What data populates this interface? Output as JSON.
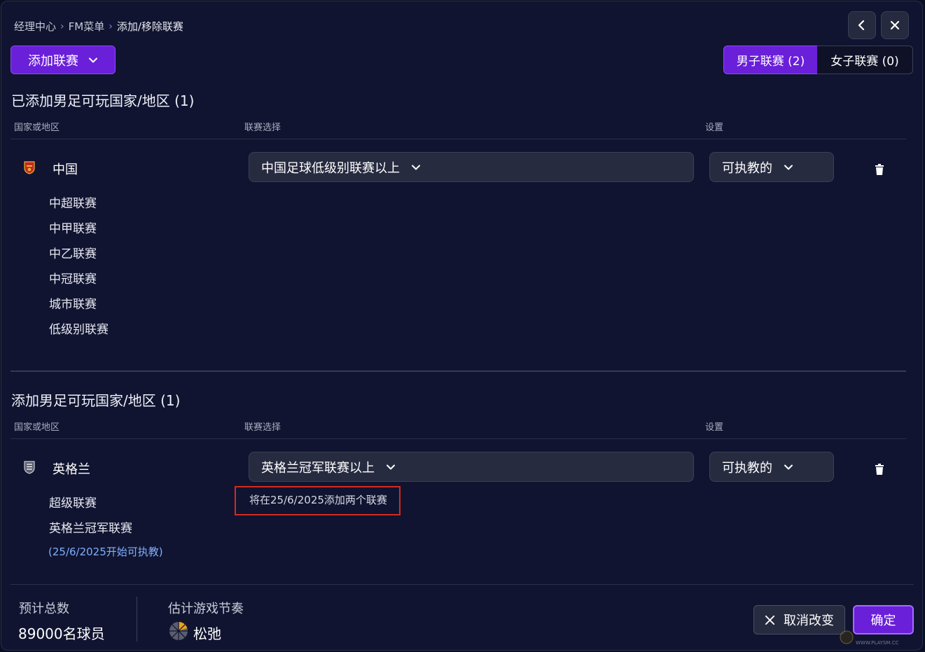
{
  "breadcrumb": {
    "items": [
      "经理中心",
      "FM菜单",
      "添加/移除联赛"
    ]
  },
  "header": {
    "add_league_label": "添加联赛",
    "tabs": {
      "men": "男子联赛 (2)",
      "women": "女子联赛 (0)"
    }
  },
  "added_section": {
    "title": "已添加男足可玩国家/地区 (1)",
    "columns": {
      "country": "国家或地区",
      "league_select": "联赛选择",
      "settings": "设置"
    },
    "country": {
      "name": "中国",
      "league_select": "中国足球低级别联赛以上",
      "setting": "可执教的",
      "leagues": [
        "中超联赛",
        "中甲联赛",
        "中乙联赛",
        "中冠联赛",
        "城市联赛",
        "低级别联赛"
      ]
    }
  },
  "adding_section": {
    "title": "添加男足可玩国家/地区 (1)",
    "columns": {
      "country": "国家或地区",
      "league_select": "联赛选择",
      "settings": "设置"
    },
    "country": {
      "name": "英格兰",
      "league_select": "英格兰冠军联赛以上",
      "setting": "可执教的",
      "leagues": [
        "超级联赛",
        "英格兰冠军联赛"
      ],
      "note": "(25/6/2025开始可执教)",
      "notice": "将在25/6/2025添加两个联赛"
    }
  },
  "footer": {
    "total_label": "预计总数",
    "total_value": "89000名球员",
    "pace_label": "估计游戏节奏",
    "pace_value": "松弛",
    "cancel_label": "取消改变",
    "confirm_label": "确定"
  },
  "watermark": {
    "text": "WWW.PLAYSM.CC"
  },
  "colors": {
    "accent": "#6a1fd9",
    "background": "#101430",
    "highlight_box": "#d42a1f",
    "note": "#7fb0ff"
  }
}
